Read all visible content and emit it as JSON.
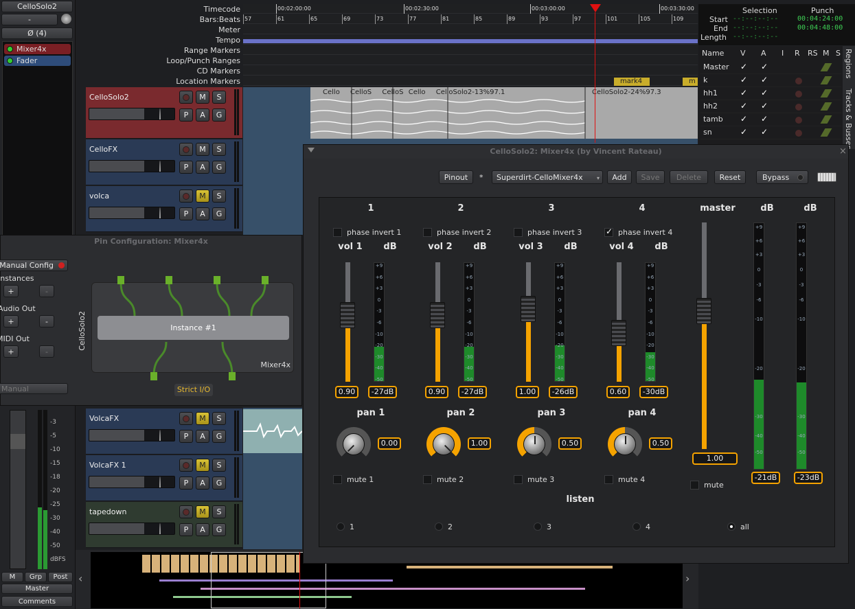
{
  "editor": {
    "strip_name": "CelloSolo2",
    "minus_label": "-",
    "phase_label": "Ø (4)",
    "plugins": [
      "Mixer4x",
      "Fader"
    ],
    "ruler_labels": [
      "Timecode",
      "Bars:Beats",
      "Meter",
      "Tempo",
      "Range Markers",
      "Loop/Punch Ranges",
      "CD Markers",
      "Location Markers"
    ],
    "timecodes": [
      "00:02:00:00",
      "00:02:30:00",
      "00:03:00:00",
      "00:03:30:00"
    ],
    "bars": [
      "57",
      "61",
      "65",
      "69",
      "73",
      "77",
      "81",
      "85",
      "89",
      "93",
      "97",
      "101",
      "105",
      "109"
    ],
    "markers": [
      "mark4",
      "m"
    ],
    "region_labels": [
      "Cello",
      "CelloS",
      "CelloS",
      "Cello",
      "CelloSolo2-13%97.1",
      "CelloSolo2-24%97.3"
    ],
    "tracks_top": [
      {
        "name": "CelloSolo2",
        "mute_on": false
      },
      {
        "name": "CelloFX",
        "mute_on": false
      },
      {
        "name": "volca",
        "mute_on": true
      }
    ],
    "tracks_bottom": [
      {
        "name": "VolcaFX",
        "mute_on": true
      },
      {
        "name": "VolcaFX 1",
        "mute_on": true
      },
      {
        "name": "tapedown",
        "mute_on": true
      }
    ],
    "track_btn": {
      "m": "M",
      "s": "S",
      "p": "P",
      "a": "A",
      "g": "G"
    },
    "strip_meter_ticks": [
      "-3",
      "-5",
      "-10",
      "-15",
      "-18",
      "-20",
      "-25",
      "-30",
      "-40",
      "-50",
      "dBFS"
    ],
    "strip_bottom": {
      "m": "M",
      "grp": "Grp",
      "post": "Post",
      "master": "Master",
      "comments": "Comments"
    },
    "nav_left": "‹",
    "nav_right": "›"
  },
  "selection_panel": {
    "selection_title": "Selection",
    "punch_title": "Punch",
    "start_label": "Start",
    "end_label": "End",
    "length_label": "Length",
    "empty_time": "--:--:--:--",
    "punch_start": "00:04:24:00",
    "punch_end": "00:04:48:00"
  },
  "tracks_list": {
    "headers": [
      "Name",
      "V",
      "A",
      "I",
      "R",
      "RS",
      "M",
      "S"
    ],
    "rows": [
      "Master",
      "k",
      "hh1",
      "hh2",
      "tamb",
      "sn"
    ],
    "tabs": [
      "Regions",
      "Tracks & Busses"
    ]
  },
  "pin_config": {
    "title": "Pin Configuration: Mixer4x",
    "manual_config": "Manual Config",
    "instances_label": "Instances",
    "audio_out_label": "Audio Out",
    "midi_out_label": "MIDI Out",
    "plus": "+",
    "minus": "-",
    "mode_select": "Manual",
    "side_label": "CelloSolo2",
    "instance_label": "Instance #1",
    "plugin_name": "Mixer4x",
    "strict_io": "Strict I/O"
  },
  "plugin": {
    "title": "CelloSolo2: Mixer4x (by Vincent Rateau)",
    "pinout": "Pinout",
    "star": "*",
    "preset": "Superdirt-CelloMixer4x",
    "add": "Add",
    "save": "Save",
    "delete": "Delete",
    "reset": "Reset",
    "bypass": "Bypass",
    "vol_label": "vol",
    "db_label": "dB",
    "pan_label": "pan",
    "master_label": "master",
    "mute_label": "mute",
    "listen_label": "listen",
    "channels": [
      {
        "num": "1",
        "phase": "phase invert 1",
        "phase_on": false,
        "vol_label": "vol 1",
        "vol": "0.90",
        "vol_level": 0.45,
        "db": "-27dB",
        "db_level": 0.29,
        "pan_label": "pan 1",
        "pan": "0.00",
        "pan_level": 0.0,
        "mute": "mute 1",
        "listen": "1"
      },
      {
        "num": "2",
        "phase": "phase invert 2",
        "phase_on": false,
        "vol_label": "vol 2",
        "vol": "0.90",
        "vol_level": 0.45,
        "db": "-27dB",
        "db_level": 0.29,
        "pan_label": "pan 2",
        "pan": "1.00",
        "pan_level": 1.0,
        "mute": "mute 2",
        "listen": "2"
      },
      {
        "num": "3",
        "phase": "phase invert 3",
        "phase_on": false,
        "vol_label": "vol 3",
        "vol": "1.00",
        "vol_level": 0.5,
        "db": "-26dB",
        "db_level": 0.3,
        "pan_label": "pan 3",
        "pan": "0.50",
        "pan_level": 0.5,
        "mute": "mute 3",
        "listen": "3"
      },
      {
        "num": "4",
        "phase": "phase invert 4",
        "phase_on": true,
        "vol_label": "vol 4",
        "vol": "0.60",
        "vol_level": 0.3,
        "db": "-30dB",
        "db_level": 0.24,
        "pan_label": "pan 4",
        "pan": "0.50",
        "pan_level": 0.5,
        "mute": "mute 4",
        "listen": "4"
      }
    ],
    "master_vol": "1.00",
    "master_level": 0.55,
    "master_db": [
      {
        "value": "-21dB",
        "level": 0.36
      },
      {
        "value": "-23dB",
        "level": 0.35
      }
    ],
    "listen_all": "all",
    "db_ticks_small": [
      "+9",
      "+6",
      "+3",
      "0",
      "-3",
      "-6",
      "-10",
      "-20",
      "-30",
      "-40",
      "-50"
    ],
    "db_ticks_big": [
      "+9",
      "+6",
      "+3",
      "0",
      "-3",
      "-6",
      "-10",
      "-20",
      "-30",
      "-40",
      "-50"
    ],
    "colors": {
      "accent": "#f5a300",
      "meter": "#1e8a2a"
    }
  }
}
